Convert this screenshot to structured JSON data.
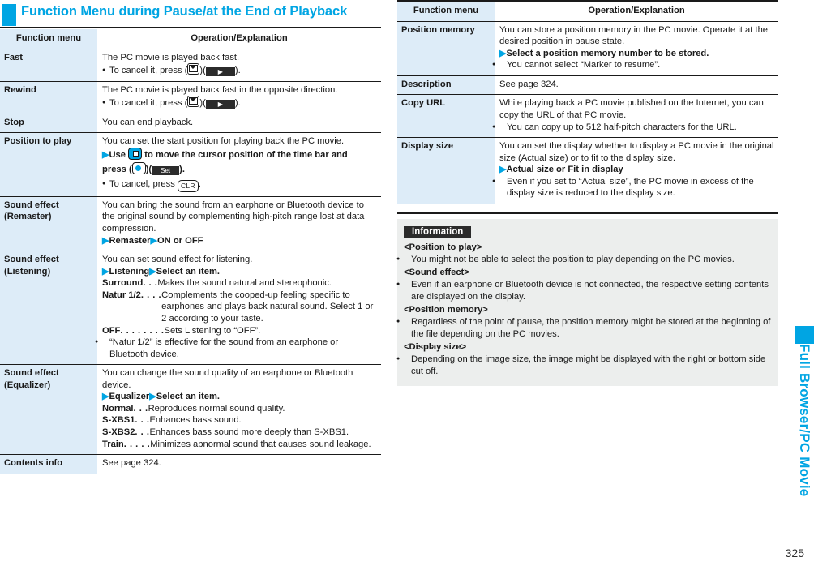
{
  "section": {
    "title": "Function Menu during Pause/at the End of Playback",
    "accent_color": "#00a5e3"
  },
  "table_headers": {
    "function_menu": "Function menu",
    "operation": "Operation/Explanation"
  },
  "left_table": {
    "rows": [
      {
        "menu": "Fast",
        "line1": "The PC movie is played back fast.",
        "bullet1_pre": "To cancel it, press",
        "bullet1_post": ").",
        "key_mail": "mail-key",
        "softkey": "play-softkey"
      },
      {
        "menu": "Rewind",
        "line1": "The PC movie is played back fast in the opposite direction.",
        "bullet1_pre": "To cancel it, press",
        "bullet1_post": ").",
        "key_mail": "mail-key",
        "softkey": "play-softkey"
      },
      {
        "menu": "Stop",
        "line1": "You can end playback."
      },
      {
        "menu": "Position to play",
        "line1": "You can set the start position for playing back the PC movie.",
        "step_a1": "Use",
        "step_a2": "to move the cursor position of the time bar and",
        "step_a3": "press",
        "softkey_set": "Set",
        "step_a4": ").",
        "bullet_pre": "To cancel, press",
        "key_clr": "CLR",
        "bullet_post": "."
      },
      {
        "menu": "Sound effect\n(Remaster)",
        "menu_l1": "Sound effect",
        "menu_l2": "(Remaster)",
        "para": "You can bring the sound from an earphone or Bluetooth device to the original sound by complementing high-pitch range lost at data compression.",
        "step1": "Remaster",
        "step2": "ON or OFF"
      },
      {
        "menu_l1": "Sound effect",
        "menu_l2": "(Listening)",
        "para": "You can set sound effect for listening.",
        "step1": "Listening",
        "step2": "Select an item.",
        "defs": [
          {
            "term": "Surround",
            "dots": " . . .",
            "def": "Makes the sound natural and stereophonic."
          },
          {
            "term": "Natur 1/2",
            "dots": " . . . .",
            "def": "Complements the cooped-up feeling specific to earphones and plays back natural sound. Select 1 or 2 according to your taste."
          },
          {
            "term": "OFF",
            "dots": " . . . . . . . .",
            "def": "Sets Listening to “OFF”."
          }
        ],
        "bullet": "“Natur 1/2” is effective for the sound from an earphone or Bluetooth device."
      },
      {
        "menu_l1": "Sound effect",
        "menu_l2": "(Equalizer)",
        "para": "You can change the sound quality of an earphone or Bluetooth device.",
        "step1": "Equalizer",
        "step2": "Select an item.",
        "defs": [
          {
            "term": "Normal",
            "dots": " . . .",
            "def": "Reproduces normal sound quality."
          },
          {
            "term": "S-XBS1",
            "dots": " . . .",
            "def": "Enhances bass sound."
          },
          {
            "term": "S-XBS2",
            "dots": " . . .",
            "def": "Enhances bass sound more deeply than S-XBS1."
          },
          {
            "term": "Train",
            "dots": " . . . . .",
            "def": "Minimizes abnormal sound that causes sound leakage."
          }
        ]
      },
      {
        "menu": "Contents info",
        "line1": "See page 324."
      }
    ]
  },
  "right_table": {
    "rows": [
      {
        "menu": "Position memory",
        "para": "You can store a position memory in the PC movie. Operate it at the desired position in pause state.",
        "step1": "Select a position memory number to be stored.",
        "bullet": "You cannot select “Marker to resume”."
      },
      {
        "menu": "Description",
        "para": "See page 324."
      },
      {
        "menu": "Copy URL",
        "para": "While playing back a PC movie published on the Internet, you can copy the URL of that PC movie.",
        "bullet": "You can copy up to 512 half-pitch characters for the URL."
      },
      {
        "menu": "Display size",
        "para": "You can set the display whether to display a PC movie in the original size (Actual size) or to fit to the display size.",
        "step1": "Actual size or Fit in display",
        "bullet": "Even if you set to “Actual size”, the PC movie in excess of the display size is reduced to the display size."
      }
    ]
  },
  "information": {
    "header": "Information",
    "entries": [
      {
        "sub": "<Position to play>",
        "bullets": [
          "You might not be able to select the position to play depending on the PC movies."
        ]
      },
      {
        "sub": "<Sound effect>",
        "bullets": [
          "Even if an earphone or Bluetooth device is not connected, the respective setting contents are displayed on the display."
        ]
      },
      {
        "sub": "<Position memory>",
        "bullets": [
          "Regardless of the point of pause, the position memory might be stored at the beginning of the file depending on the PC movies."
        ]
      },
      {
        "sub": "<Display size>",
        "bullets": [
          "Depending on the image size, the image might be displayed with the right or bottom side cut off."
        ]
      }
    ]
  },
  "edge": {
    "chapter_label": "Full Browser/PC Movie",
    "color": "#00a5e3"
  },
  "page_number": "325"
}
